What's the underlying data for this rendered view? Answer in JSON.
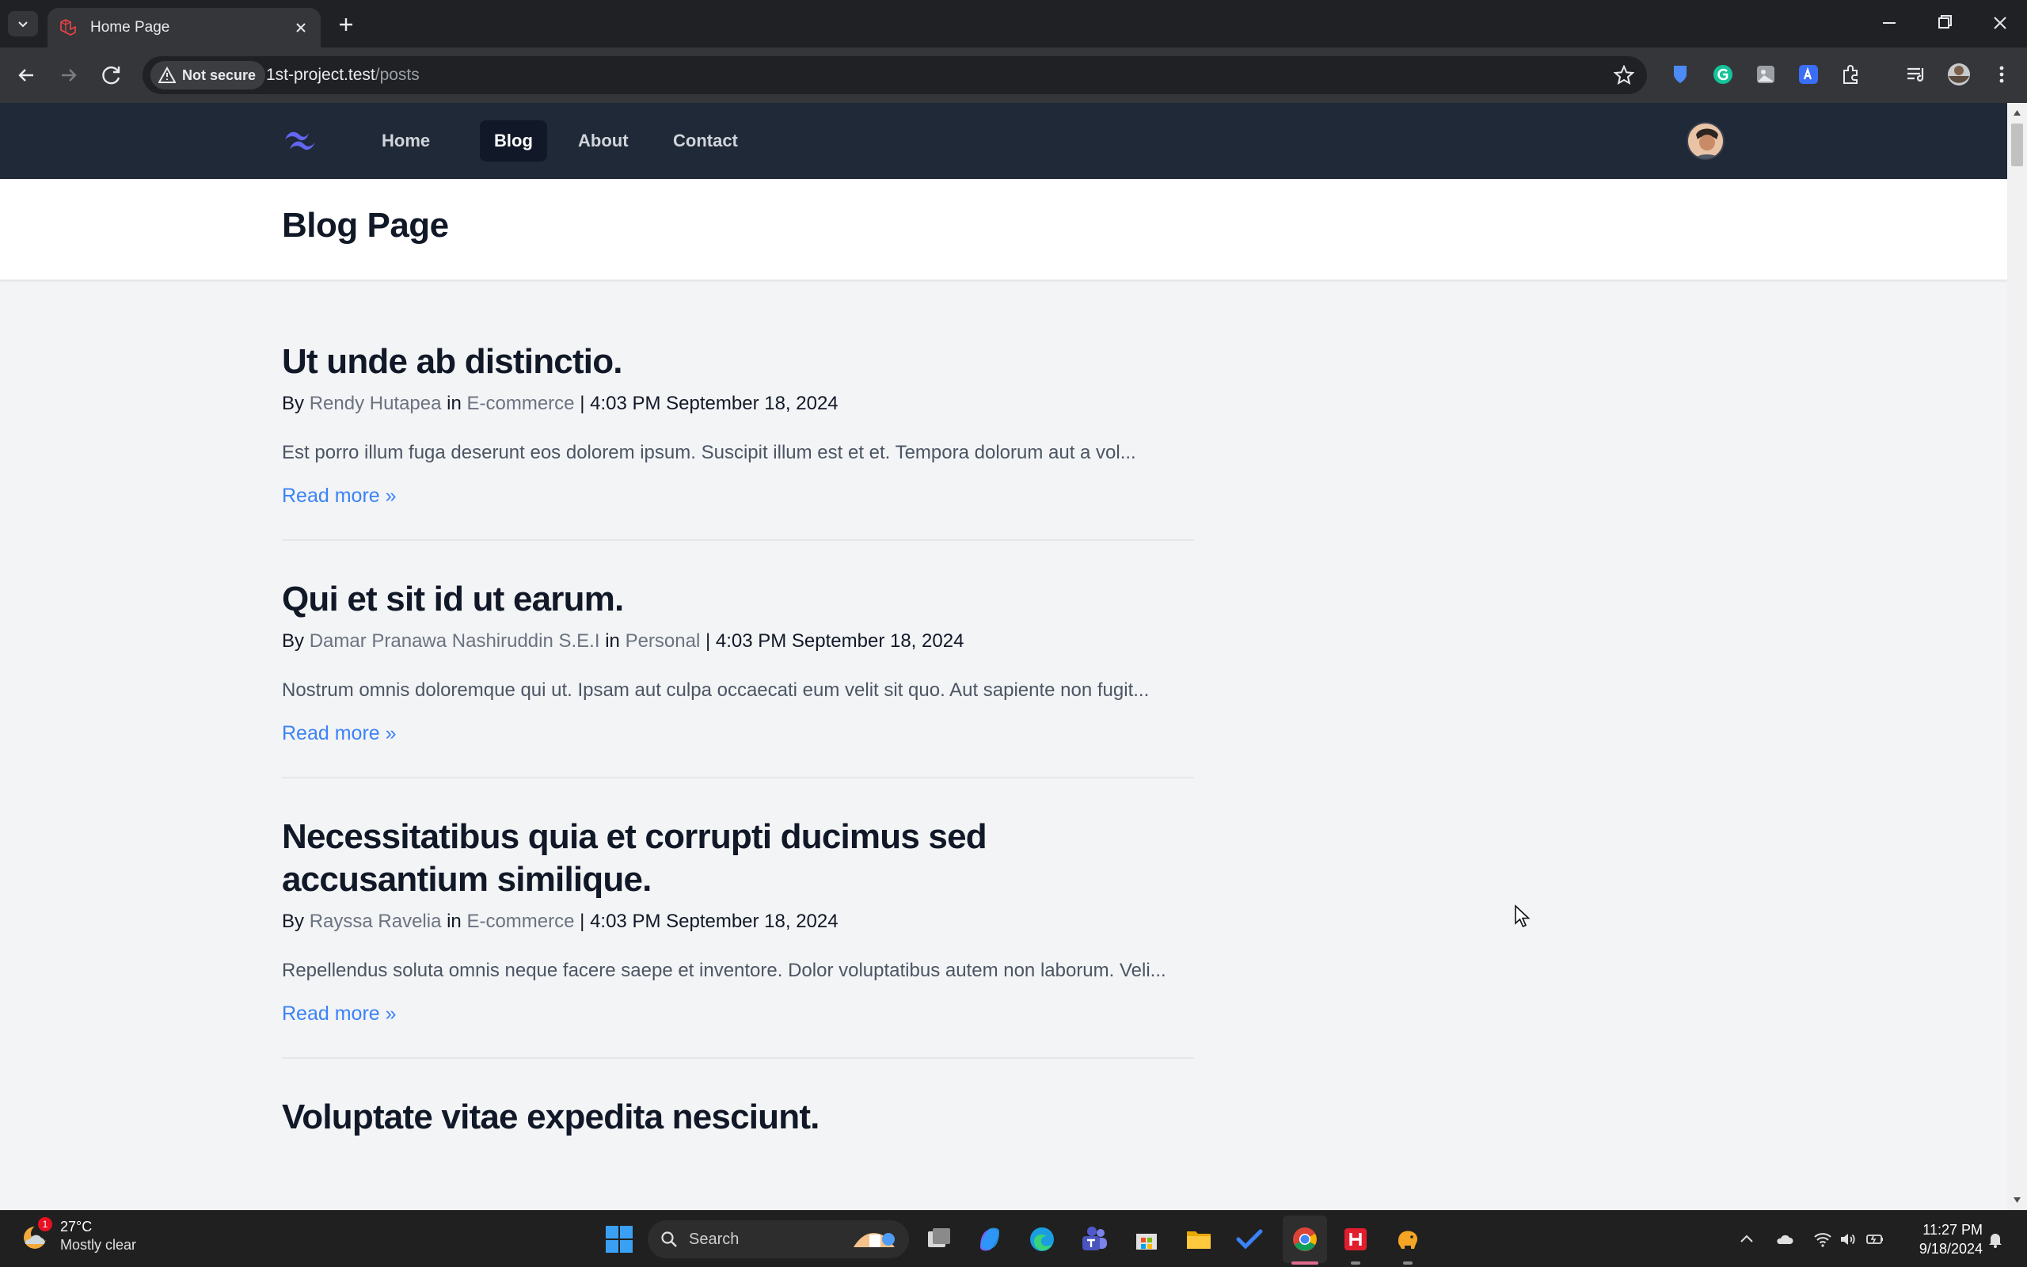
{
  "browser": {
    "tab_title": "Home Page",
    "security_label": "Not secure",
    "url_host": "1st-project.test",
    "url_path": "/posts"
  },
  "site": {
    "nav": [
      {
        "label": "Home",
        "active": false
      },
      {
        "label": "Blog",
        "active": true
      },
      {
        "label": "About",
        "active": false
      },
      {
        "label": "Contact",
        "active": false
      }
    ],
    "page_title": "Blog Page"
  },
  "posts": [
    {
      "title": "Ut unde ab distinctio.",
      "by": "By",
      "author": "Rendy Hutapea",
      "in": "in",
      "category": "E-commerce",
      "date": "4:03 PM September 18, 2024",
      "excerpt": "Est porro illum fuga deserunt eos dolorem ipsum. Suscipit illum est et et. Tempora dolorum aut a vol...",
      "read_more": "Read more »"
    },
    {
      "title": "Qui et sit id ut earum.",
      "by": "By",
      "author": "Damar Pranawa Nashiruddin S.E.I",
      "in": "in",
      "category": "Personal",
      "date": "4:03 PM September 18, 2024",
      "excerpt": "Nostrum omnis doloremque qui ut. Ipsam aut culpa occaecati eum velit sit quo. Aut sapiente non fugit...",
      "read_more": "Read more »"
    },
    {
      "title": "Necessitatibus quia et corrupti ducimus sed accusantium similique.",
      "by": "By",
      "author": "Rayssa Ravelia",
      "in": "in",
      "category": "E-commerce",
      "date": "4:03 PM September 18, 2024",
      "excerpt": "Repellendus soluta omnis neque facere saepe et inventore. Dolor voluptatibus autem non laborum. Veli...",
      "read_more": "Read more »"
    },
    {
      "title": "Voluptate vitae expedita nesciunt."
    }
  ],
  "taskbar": {
    "weather_temp": "27°C",
    "weather_desc": "Mostly clear",
    "weather_badge": "1",
    "search_placeholder": "Search",
    "time": "11:27 PM",
    "date": "9/18/2024"
  },
  "colors": {
    "nav_bg": "#1f2937",
    "link_blue": "#3b82f6",
    "page_bg": "#f3f4f6"
  }
}
